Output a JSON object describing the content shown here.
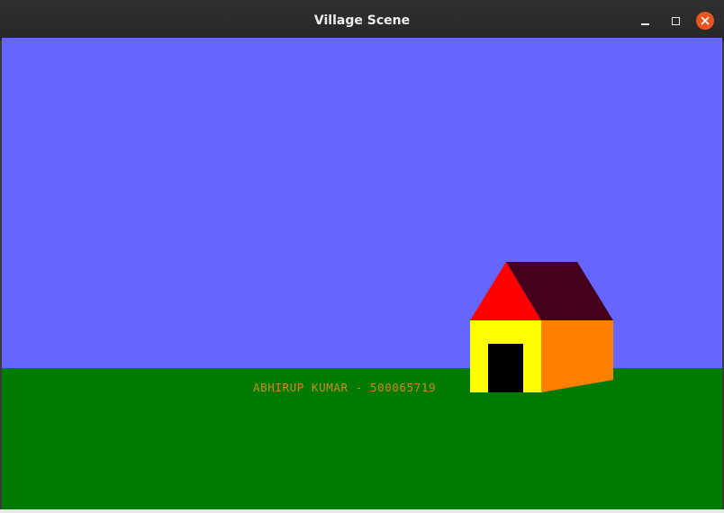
{
  "window": {
    "title": "Village Scene"
  },
  "scene": {
    "credit_text": "ABHIRUP KUMAR - 500065719",
    "colors": {
      "sky": "#6666ff",
      "ground": "#007a00",
      "roof_front": "#ff0000",
      "roof_side": "#45001e",
      "wall_front": "#ffff00",
      "wall_side": "#ff8000",
      "door": "#000000",
      "credit_text": "#d08a1a"
    }
  },
  "icons": {
    "minimize": "minimize-icon",
    "maximize": "maximize-icon",
    "close": "close-icon"
  }
}
